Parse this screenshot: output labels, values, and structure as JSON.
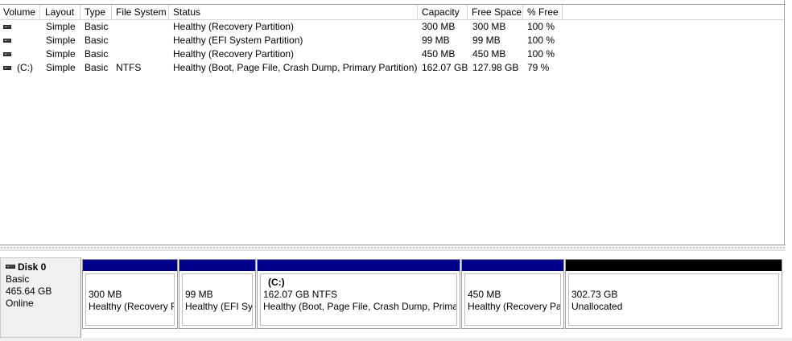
{
  "volume_list": {
    "columns": [
      "Volume",
      "Layout",
      "Type",
      "File System",
      "Status",
      "Capacity",
      "Free Space",
      "% Free"
    ],
    "rows": [
      {
        "volume": "",
        "layout": "Simple",
        "type": "Basic",
        "file_system": "",
        "status": "Healthy (Recovery Partition)",
        "capacity": "300 MB",
        "free_space": "300 MB",
        "pct_free": "100 %"
      },
      {
        "volume": "",
        "layout": "Simple",
        "type": "Basic",
        "file_system": "",
        "status": "Healthy (EFI System Partition)",
        "capacity": "99 MB",
        "free_space": "99 MB",
        "pct_free": "100 %"
      },
      {
        "volume": "",
        "layout": "Simple",
        "type": "Basic",
        "file_system": "",
        "status": "Healthy (Recovery Partition)",
        "capacity": "450 MB",
        "free_space": "450 MB",
        "pct_free": "100 %"
      },
      {
        "volume": "(C:)",
        "layout": "Simple",
        "type": "Basic",
        "file_system": "NTFS",
        "status": "Healthy (Boot, Page File, Crash Dump, Primary Partition)",
        "capacity": "162.07 GB",
        "free_space": "127.98 GB",
        "pct_free": "79 %"
      }
    ],
    "row_icon": "drive-icon"
  },
  "disk": {
    "name": "Disk 0",
    "type": "Basic",
    "size": "465.64 GB",
    "status": "Online",
    "icon": "disk-icon",
    "partitions": [
      {
        "label": "",
        "size": "300 MB",
        "status": "Healthy (Recovery P",
        "kind": "primary"
      },
      {
        "label": "",
        "size": "99 MB",
        "status": "Healthy (EFI Sys",
        "kind": "primary"
      },
      {
        "label": "(C:)",
        "size": "162.07 GB NTFS",
        "status": "Healthy (Boot, Page File, Crash Dump, Primar",
        "kind": "primary"
      },
      {
        "label": "",
        "size": "450 MB",
        "status": "Healthy (Recovery Pa",
        "kind": "primary"
      },
      {
        "label": "",
        "size": "302.73 GB",
        "status": "Unallocated",
        "kind": "unallocated"
      }
    ]
  },
  "colors": {
    "primary_partition_bar": "#00008b",
    "unallocated_bar": "#000000",
    "disk_label_bg": "#f0f0f0"
  }
}
